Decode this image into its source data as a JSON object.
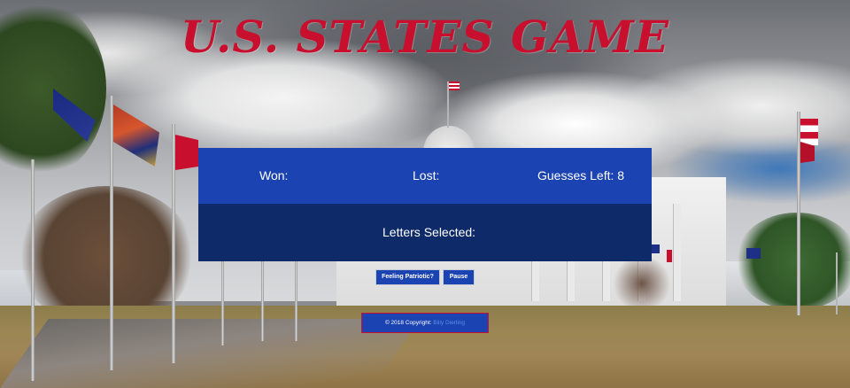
{
  "game": {
    "title": "U.S. STATES GAME",
    "word_placeholder": "_ _ _ _ _ _ _ _ _ _ _ _"
  },
  "stats": {
    "won_label": "Won:",
    "won_value": "",
    "lost_label": "Lost:",
    "lost_value": "",
    "guesses_label": "Guesses Left:",
    "guesses_value": "8"
  },
  "letters": {
    "label": "Letters Selected:",
    "value": ""
  },
  "controls": {
    "patriotic_label": "Feeling Patriotic?",
    "pause_label": "Pause"
  },
  "footer": {
    "copyright_text": "© 2018 Copyright:",
    "author_link": "Billy Dierling"
  },
  "colors": {
    "title_red": "#c8102e",
    "stats_blue": "#1c43b2",
    "letters_navy": "#0e2a69",
    "link_blue": "#5b8fe8"
  }
}
